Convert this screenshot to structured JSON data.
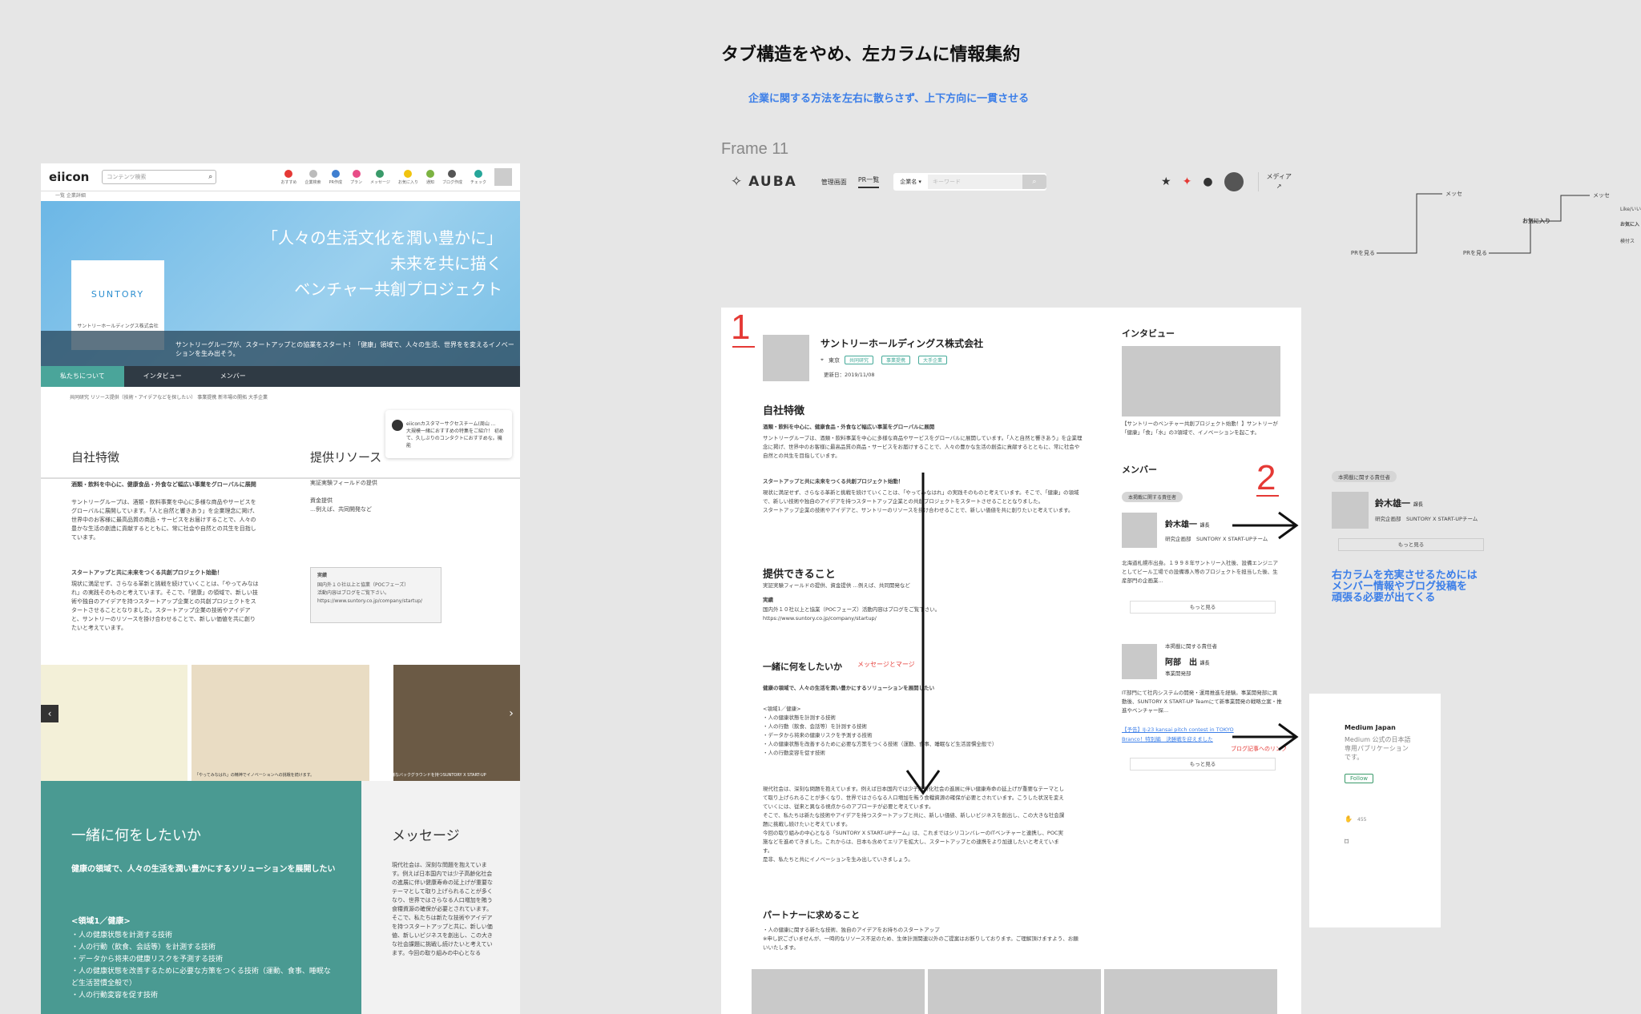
{
  "canvas": {
    "heading": "タブ構造をやめ、左カラムに情報集約",
    "subheading": "企業に関する方法を左右に散らさず、上下方向に一貫させる",
    "frame_label": "Frame 11",
    "annotation_1": "1",
    "annotation_2": "2",
    "right_note": "右カラムを充実させるためには\nメンバー情報やブログ投稿を\n頑張る必要が出てくる",
    "red_message_label": "メッセージとマージ",
    "red_blog_label": "ブログ記事へのリンク"
  },
  "left": {
    "logo": "eiicon",
    "search_placeholder": "コンテンツ検索",
    "icons": [
      "おすすめ",
      "企業検索",
      "PR作成",
      "プラン",
      "メッセージ",
      "お気に入り",
      "通知",
      "ブログ作成",
      "チェック"
    ],
    "breadcrumb": "一覧  企業詳細",
    "hero_line1": "「人々の生活文化を潤い豊かに」",
    "hero_line2": "未来を共に描く",
    "hero_line3": "ベンチャー共創プロジェクト",
    "brand": "SUNTORY",
    "company": "サントリーホールディングス株式会社",
    "hero_band": "サントリーグループが、スタートアップとの協業をスタート！「健康」領域で、人々の生活、世界をを変えるイノベーションを生み出そう。",
    "tabs": [
      "私たちについて",
      "インタビュー",
      "メンバー"
    ],
    "tags": "共同研究  リソース提供（技術・アイデアなどを探したい）  事業提携  新市場の開拓  大手企業",
    "notif": "eiiconカスタマーサクセスチーム(周山 ...\n大規模一緒におすすめの特集をご紹介！ 初めて、久しぶりのコンタクトにおすすめな。機能",
    "sec_feature": "自社特徴",
    "sec_resource": "提供リソース",
    "feature_head": "酒類・飲料を中心に、健康食品・外食など幅広い事業をグローバルに展開",
    "feature_body": "サントリーグループは、酒類・飲料事業を中心に多様な商品やサービスをグローバルに展開しています。「人と自然と響きあう」を企業理念に掲げ、世界中のお客様に最高品質の商品・サービスをお届けすることで、人々の豊かな生活の創造に貢献するとともに、常に社会や自然との共生を目指しています。",
    "feature_head2": "スタートアップと共に未来をつくる共創プロジェクト始動！",
    "feature_body2": "現状に満足せず、さらなる革新と挑戦を続けていくことは、「やってみなはれ」の実践そのものと考えています。そこで、「健康」の領域で、新しい技術や独自のアイデアを持つスタートアップ企業との共創プロジェクトをスタートさせることとなりました。スタートアップ企業の技術やアイデアと、サントリーのリソースを掛け合わせることで、新しい価値を共に創りたいと考えています。",
    "resource_body": "実証実験フィールドの提供\n\n資金提供\n…例えば、共同開発など",
    "box_title": "実績",
    "box_body": "国内外１０社以上と協業（POCフェーズ）\n活動内容はブログをご覧下さい。\nhttps://www.suntory.co.jp/company/startup/",
    "gallery_caption1": "「やってみなはれ」の精神でイノベーションへの挑戦を続けます。",
    "gallery_caption2": "多様なバックグラウンドを持つSUNTORY X START-UP",
    "want_title": "一緒に何をしたいか",
    "want_sub": "健康の領域で、人々の生活を潤い豊かにするソリューションを展開したい",
    "want_area": "<領域1／健康>",
    "want_list": "・人の健康状態を計測する技術\n・人の行動（飲食、会話等）を計測する技術\n・データから将来の健康リスクを予測する技術\n・人の健康状態を改善するために必要な方策をつくる技術（運動、食事、睡眠など生活習慣全般で）\n・人の行動変容を促す技術",
    "msg_title": "メッセージ",
    "msg_body": "現代社会は、深刻な問題を抱えています。例えば日本国内では少子高齢化社会の進展に伴い健康寿命の延上げが重要なテーマとして取り上げられることが多くなり、世界ではさらなる人口増加を賄う食糧資源の確保が必要とされています。そこで、私たちは新たな技術やアイデアを持つスタートアップと共に、新しい価値、新しいビジネスを創出し、この大きな社会課題に挑戦し続けたいと考えています。今回の取り組みの中心となる"
  },
  "mid": {
    "logo": "AUBA",
    "nav": [
      "管理画面",
      "PR一覧"
    ],
    "search_select": "企業名",
    "search_placeholder": "キーワード",
    "media": "メディア",
    "company": "サントリーホールディングス株式会社",
    "location": "東京",
    "chips": [
      "共同研究",
      "事業提携",
      "大手企業"
    ],
    "updated": "更新日：2019/11/08",
    "sec_feature": "自社特徴",
    "feature_head": "酒類・飲料を中心に、健康食品・外食など幅広い事業をグローバルに展開",
    "feature_body": "サントリーグループは、酒類・飲料事業を中心に多様な商品やサービスをグローバルに展開しています。「人と自然と響きあう」を企業理念に掲げ、世界中のお客様に最高品質の商品・サービスをお届けすることで、人々の豊かな生活の創造に貢献するとともに、常に社会や自然との共生を目指しています。",
    "feature_head2": "スタートアップと共に未来をつくる共創プロジェクト始動！",
    "feature_body2": "現状に満足せず、さらなる革新と挑戦を続けていくことは、「やってみなはれ」の実践そのものと考えています。そこで、「健康」の領域で、新しい技術や独自のアイデアを持つスタートアップ企業との共創プロジェクトをスタートさせることとなりました。\nスタートアップ企業の技術やアイデアと、サントリーのリソースを掛け合わせることで、新しい価値を共に創りたいと考えています。",
    "sec_provide": "提供できること",
    "provide_body": "実証実験フィールドの提供、資金提供 …例えば、共同開発など",
    "provide_result_title": "実績",
    "provide_result": "国内外１０社以上と協業（POCフェーズ）活動内容はブログをご覧下さい。\nhttps://www.suntory.co.jp/company/startup/",
    "sec_want": "一緒に何をしたいか",
    "want_sub": "健康の領域で、人々の生活を潤い豊かにするソリューションを展開したい",
    "want_list": "<領域1／健康>\n・人の健康状態を計測する技術\n・人の行動（飲食、会話等）を計測する技術\n・データから将来の健康リスクを予測する技術\n・人の健康状態を改善するために必要な方策をつくる技術（運動、食事、睡眠など生活習慣全般で）\n・人の行動変容を促す技術",
    "want_message": "現代社会は、深刻な問題を抱えています。例えば日本国内では少子高齢化社会の進展に伴い健康寿命の延上げが重要なテーマとして取り上げられることが多くなり、世界ではさらなる人口増加を賄う食糧資源の確保が必要とされています。こうした状況を変えていくには、従来と異なる視点からのアプローチが必要と考えています。\nそこで、私たちは新たな技術やアイデアを持つスタートアップと共に、新しい価値、新しいビジネスを創出し、この大きな社会課題に挑戦し続けたいと考えています。\n今回の取り組みの中心となる「SUNTORY X START-UPチーム」は、これまではシリコンバレーのITベンチャーと連携し、POC実施などを進めてきました。これからは、日本も含めてエリアを拡大し、スタートアップとの連携をより加速したいと考えています。\n是非、私たちと共にイノベーションを生み出していきましょう。",
    "sec_partner": "パートナーに求めること",
    "partner_body": "・人の健康に関する新たな技術、独自のアイデアをお持ちのスタートアップ\n※申し訳ございませんが、一時的なリソース不足のため、生体計測関連以外のご提案はお断りしております。ご理解頂けますよう、お願いいたします。",
    "side_interview_title": "インタビュー",
    "side_interview_caption": "【サントリーのベンチャー共創プロジェクト始動！】サントリーが「健康」「食」「水」の3領域で、イノベーションを起こす。",
    "side_member_title": "メンバー",
    "side_member_badge": "本掲載に関する責任者",
    "member1_name": "鈴木雄一",
    "member1_role": "課長",
    "member1_org": "研究企画部　SUNTORY X START-UPチーム",
    "member1_bio": "北海道札幌市出身。１９９８年サントリー入社後、設備エンジニアとしてビール工場での設備導入等のプロジェクトを担当した後、生産部門の企画業...",
    "more": "もっと見る",
    "member2_badge": "本掲載に関する責任者",
    "member2_name": "阿部　出",
    "member2_role": "課長",
    "member2_org": "事業開発部",
    "member2_bio": "IT部門にて社内システムの開発・運用推進を経験。事業開発部に異動後、SUNTORY X START-UP Teamにて新事業開発の戦略立案・推進やベンチャー探...",
    "member2_link1": "【予告】IJ-23 kansai pitch contest in TOKYO",
    "member2_link2": "Branco！特別編　決勝戦を迎えました"
  },
  "right": {
    "flow_labels": [
      "メッセ",
      "PRを見る",
      "お気に入り",
      "PRを見る",
      "メッセ",
      "Like/いい",
      "お気に入",
      "検付ス"
    ],
    "badge": "本掲載に関する責任者",
    "member_name": "鈴木雄一",
    "member_role": "課長",
    "member_org": "研究企画部　SUNTORY X START-UPチーム",
    "more": "もっと見る",
    "medium_title": "Medium Japan",
    "medium_desc": "Medium 公式の日本語専用パブリケーションです。",
    "follow": "Follow",
    "claps": "455"
  }
}
